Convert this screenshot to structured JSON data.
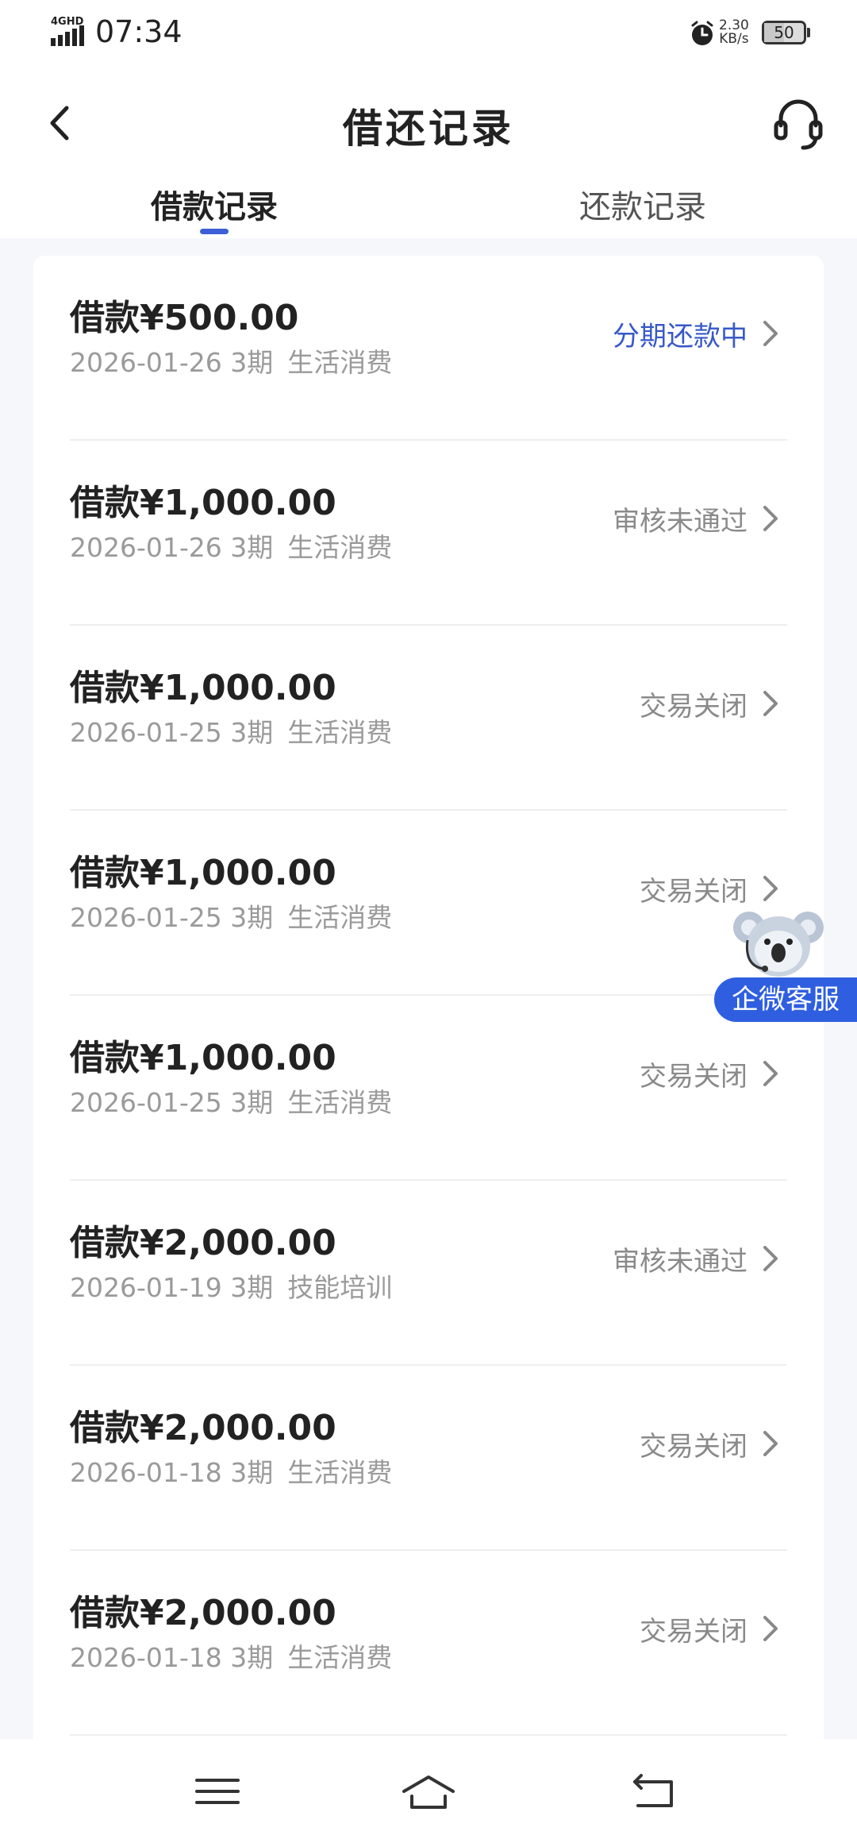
{
  "status_bar": {
    "network": "4GHD",
    "time": "07:34",
    "speed_value": "2.30",
    "speed_unit": "KB/s",
    "battery": "50",
    "battery_level_percent": 50,
    "icons": [
      "signal-icon",
      "alarm-icon",
      "battery-icon"
    ]
  },
  "header": {
    "title": "借还记录",
    "back_icon": "chevron-left-icon",
    "service_icon": "headset-icon"
  },
  "tabs": [
    {
      "label": "借款记录",
      "active": true
    },
    {
      "label": "还款记录",
      "active": false
    }
  ],
  "accent_color": "#3d5ed6",
  "records": [
    {
      "amount": "借款¥500.00",
      "date_term": "2026-01-26 3期",
      "category": "生活消费",
      "status": "分期还款中",
      "active": true
    },
    {
      "amount": "借款¥1,000.00",
      "date_term": "2026-01-26 3期",
      "category": "生活消费",
      "status": "审核未通过",
      "active": false
    },
    {
      "amount": "借款¥1,000.00",
      "date_term": "2026-01-25 3期",
      "category": "生活消费",
      "status": "交易关闭",
      "active": false
    },
    {
      "amount": "借款¥1,000.00",
      "date_term": "2026-01-25 3期",
      "category": "生活消费",
      "status": "交易关闭",
      "active": false
    },
    {
      "amount": "借款¥1,000.00",
      "date_term": "2026-01-25 3期",
      "category": "生活消费",
      "status": "交易关闭",
      "active": false
    },
    {
      "amount": "借款¥2,000.00",
      "date_term": "2026-01-19 3期",
      "category": "技能培训",
      "status": "审核未通过",
      "active": false
    },
    {
      "amount": "借款¥2,000.00",
      "date_term": "2026-01-18 3期",
      "category": "生活消费",
      "status": "交易关闭",
      "active": false
    },
    {
      "amount": "借款¥2,000.00",
      "date_term": "2026-01-18 3期",
      "category": "生活消费",
      "status": "交易关闭",
      "active": false
    }
  ],
  "floating_service": {
    "label": "企微客服",
    "icon": "koala-mascot-icon"
  },
  "bottom_nav": {
    "icons": [
      "menu-icon",
      "home-icon",
      "back-icon"
    ]
  }
}
